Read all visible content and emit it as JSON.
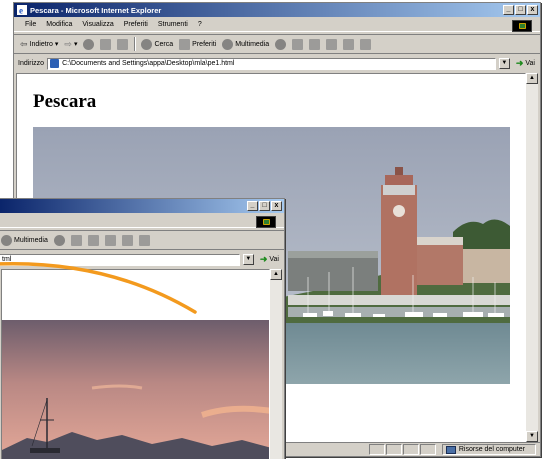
{
  "back_window": {
    "title": "Pescara - Microsoft Internet Explorer",
    "menu": [
      "File",
      "Modifica",
      "Visualizza",
      "Preferiti",
      "Strumenti",
      "?"
    ],
    "toolbar": {
      "back": "Indietro",
      "search": "Cerca",
      "favorites": "Preferiti",
      "multimedia": "Multimedia"
    },
    "address": {
      "label": "Indirizzo",
      "value": "C:\\Documents and Settings\\appa\\Desktop\\mla\\pe1.html",
      "go": "Vai"
    },
    "page": {
      "heading": "Pescara"
    },
    "status": {
      "zone": "Risorse del computer"
    }
  },
  "front_window": {
    "toolbar": {
      "multimedia": "Multimedia"
    },
    "address": {
      "value_tail": "tml",
      "go": "Vai"
    }
  },
  "colors": {
    "title_active": "#0a246a",
    "title_fade": "#a6caf0",
    "chrome": "#d4d0c8",
    "arc": "#f39a1e"
  },
  "icons": [
    "ie-icon",
    "back-arrow-icon",
    "forward-arrow-icon",
    "stop-icon",
    "refresh-icon",
    "home-icon",
    "search-icon",
    "favorites-icon",
    "multimedia-icon",
    "history-icon",
    "mail-icon",
    "print-icon",
    "edit-icon",
    "discuss-icon",
    "messenger-icon",
    "go-icon",
    "computer-icon"
  ]
}
